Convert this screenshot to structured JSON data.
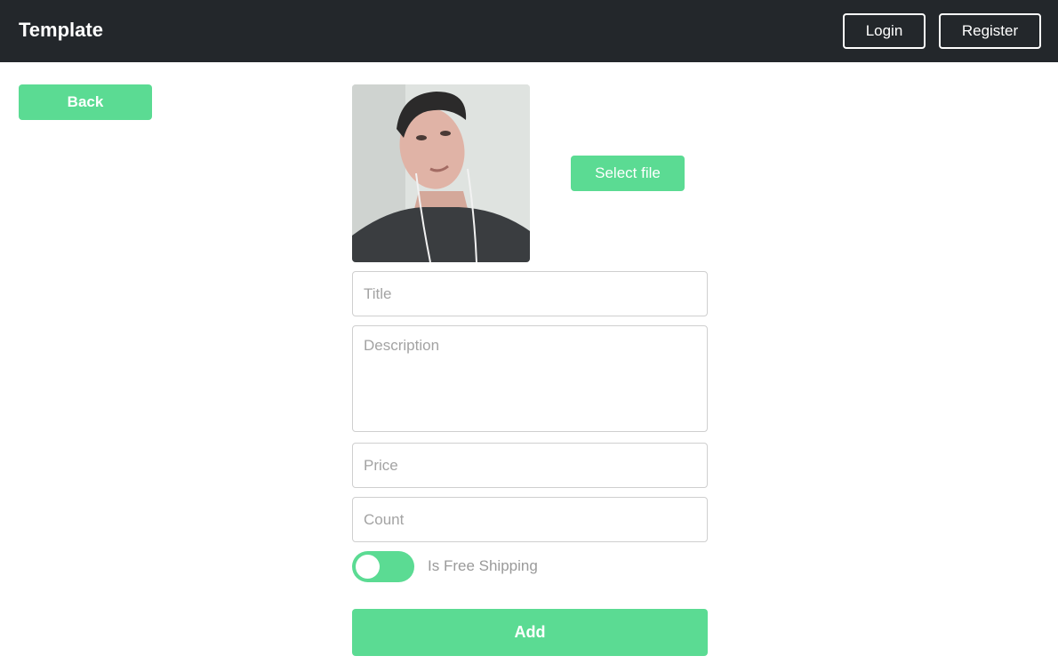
{
  "header": {
    "brand": "Template",
    "login_label": "Login",
    "register_label": "Register"
  },
  "nav": {
    "back_label": "Back"
  },
  "form": {
    "select_file_label": "Select file",
    "title_placeholder": "Title",
    "description_placeholder": "Description",
    "price_placeholder": "Price",
    "count_placeholder": "Count",
    "free_shipping_label": "Is Free Shipping",
    "free_shipping_on": false,
    "add_label": "Add"
  },
  "colors": {
    "navbar": "#23272b",
    "accent": "#5bdb93",
    "border": "#cfcfcf",
    "placeholder": "#a3a3a3"
  }
}
